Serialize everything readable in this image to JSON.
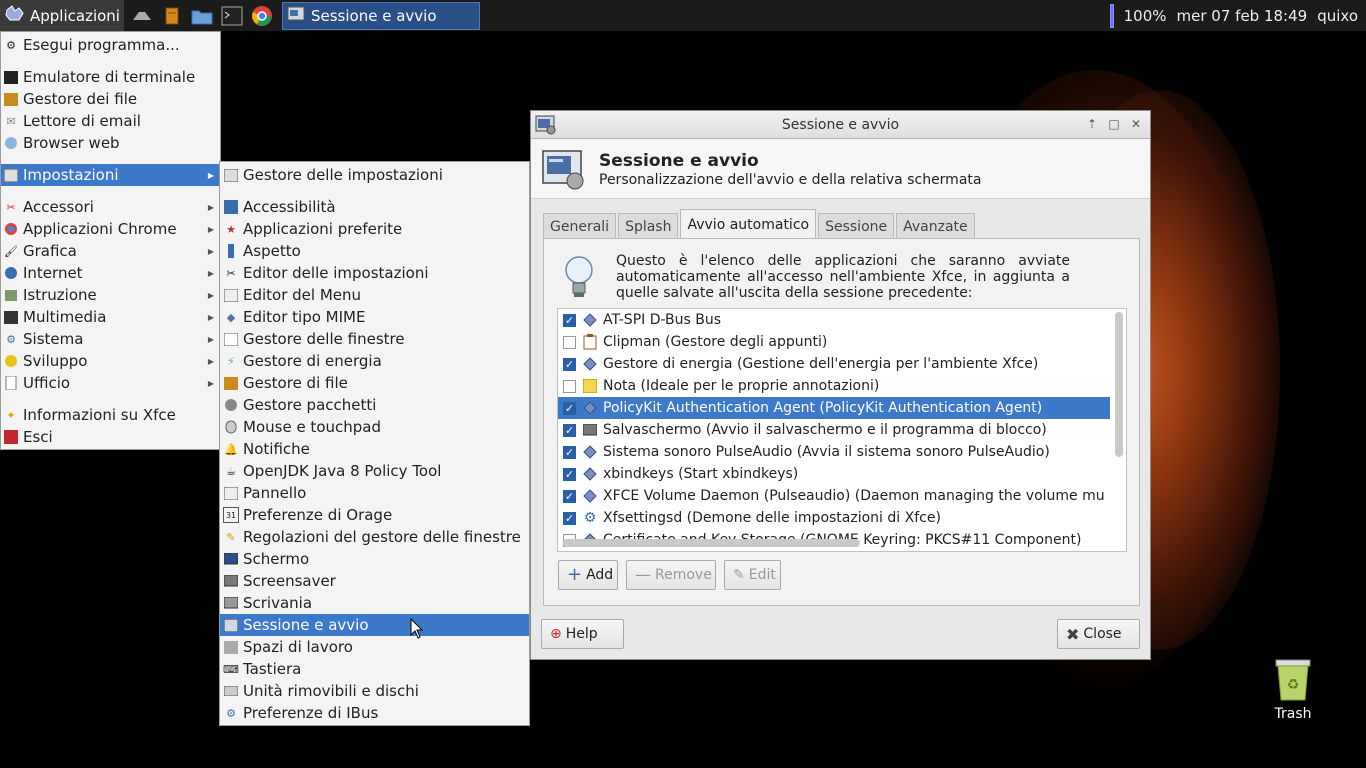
{
  "panel": {
    "app_menu_label": "Applicazioni",
    "task_label": "Sessione e avvio",
    "battery": "100%",
    "clock": "mer 07 feb 18:49",
    "user": "quixo"
  },
  "app_menu": {
    "items": [
      {
        "label": "Esegui programma...",
        "icon": "run-icon"
      },
      {
        "label": "Emulatore di terminale",
        "icon": "terminal-icon"
      },
      {
        "label": "Gestore dei file",
        "icon": "file-manager-icon"
      },
      {
        "label": "Lettore di email",
        "icon": "email-icon"
      },
      {
        "label": "Browser web",
        "icon": "web-browser-icon"
      },
      {
        "label": "Impostazioni",
        "icon": "settings-icon"
      },
      {
        "label": "Accessori",
        "icon": "accessories-icon"
      },
      {
        "label": "Applicazioni Chrome",
        "icon": "chrome-icon"
      },
      {
        "label": "Grafica",
        "icon": "graphics-icon"
      },
      {
        "label": "Internet",
        "icon": "internet-icon"
      },
      {
        "label": "Istruzione",
        "icon": "education-icon"
      },
      {
        "label": "Multimedia",
        "icon": "multimedia-icon"
      },
      {
        "label": "Sistema",
        "icon": "system-icon"
      },
      {
        "label": "Sviluppo",
        "icon": "development-icon"
      },
      {
        "label": "Ufficio",
        "icon": "office-icon"
      },
      {
        "label": "Informazioni su Xfce",
        "icon": "about-icon"
      },
      {
        "label": "Esci",
        "icon": "logout-icon"
      }
    ]
  },
  "settings_menu": {
    "items": [
      "Gestore delle impostazioni",
      "Accessibilità",
      "Applicazioni preferite",
      "Aspetto",
      "Editor delle impostazioni",
      "Editor del Menu",
      "Editor tipo MIME",
      "Gestore delle finestre",
      "Gestore di energia",
      "Gestore di file",
      "Gestore pacchetti",
      "Mouse e touchpad",
      "Notifiche",
      "OpenJDK Java 8 Policy Tool",
      "Pannello",
      "Preferenze di Orage",
      "Regolazioni del gestore delle finestre",
      "Schermo",
      "Screensaver",
      "Scrivania",
      "Sessione e avvio",
      "Spazi di lavoro",
      "Tastiera",
      "Unità rimovibili e dischi",
      "Preferenze di IBus"
    ]
  },
  "window": {
    "title": "Sessione e avvio",
    "header_title": "Sessione e avvio",
    "header_subtitle": "Personalizzazione dell'avvio e della relativa schermata",
    "tabs": [
      "Generali",
      "Splash",
      "Avvio automatico",
      "Sessione",
      "Avanzate"
    ],
    "info_text": "Questo è l'elenco delle applicazioni che saranno avviate automaticamente all'accesso nell'ambiente Xfce, in aggiunta a quelle salvate all'uscita della sessione precedente:",
    "autostart": [
      {
        "label": "AT-SPI D-Bus Bus",
        "checked": true
      },
      {
        "label": "Clipman (Gestore degli appunti)",
        "checked": false
      },
      {
        "label": "Gestore di energia (Gestione dell'energia per l'ambiente Xfce)",
        "checked": true
      },
      {
        "label": "Nota (Ideale per le proprie annotazioni)",
        "checked": false
      },
      {
        "label": "PolicyKit Authentication Agent (PolicyKit Authentication Agent)",
        "checked": true
      },
      {
        "label": "Salvaschermo (Avvio il salvaschermo e il programma di blocco)",
        "checked": true
      },
      {
        "label": "Sistema sonoro PulseAudio (Avvia il sistema sonoro PulseAudio)",
        "checked": true
      },
      {
        "label": "xbindkeys (Start xbindkeys)",
        "checked": true
      },
      {
        "label": "XFCE Volume Daemon (Pulseaudio) (Daemon managing the volume mu",
        "checked": true
      },
      {
        "label": "Xfsettingsd (Demone delle impostazioni di Xfce)",
        "checked": true
      },
      {
        "label": "Certificate and Key Storage (GNOME Keyring: PKCS#11 Component)",
        "checked": false
      }
    ],
    "add_label": "Add",
    "remove_label": "Remove",
    "edit_label": "Edit",
    "help_label": "Help",
    "close_label": "Close"
  },
  "desktop": {
    "trash_label": "Trash"
  }
}
